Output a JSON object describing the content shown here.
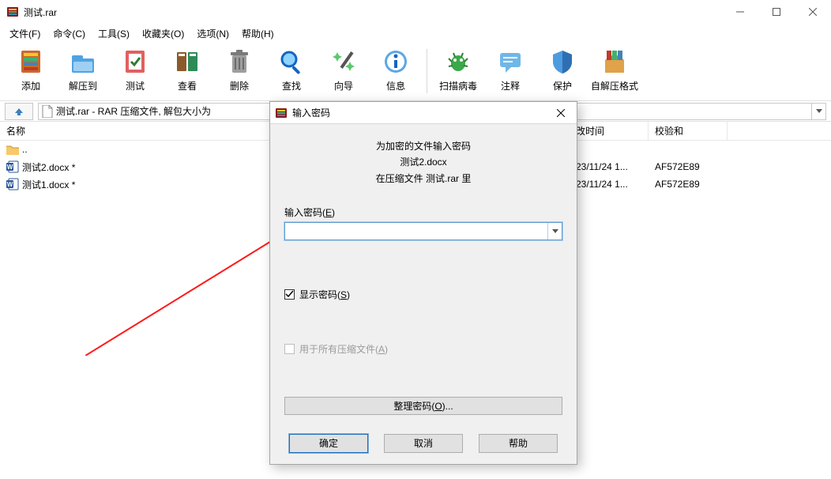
{
  "window": {
    "title": "测试.rar"
  },
  "menu": {
    "file": "文件(F)",
    "commands": "命令(C)",
    "tools": "工具(S)",
    "favorites": "收藏夹(O)",
    "options": "选项(N)",
    "help": "帮助(H)"
  },
  "toolbar": {
    "add": "添加",
    "extract": "解压到",
    "test": "测试",
    "view": "查看",
    "delete": "删除",
    "find": "查找",
    "wizard": "向导",
    "info": "信息",
    "virus": "扫描病毒",
    "comment": "注释",
    "protect": "保护",
    "sfx": "自解压格式"
  },
  "address": {
    "path": "测试.rar - RAR 压缩文件, 解包大小为"
  },
  "columns": {
    "name": "名称",
    "mtime": "改时间",
    "crc": "校验和"
  },
  "rows": [
    {
      "kind": "up",
      "name": "..",
      "mtime": "",
      "crc": ""
    },
    {
      "kind": "docx",
      "name": "测试2.docx *",
      "mtime": "23/11/24 1...",
      "crc": "AF572E89"
    },
    {
      "kind": "docx",
      "name": "测试1.docx *",
      "mtime": "23/11/24 1...",
      "crc": "AF572E89"
    }
  ],
  "dialog": {
    "title": "输入密码",
    "line1": "为加密的文件输入密码",
    "line2": "测试2.docx",
    "line3": "在压缩文件 测试.rar 里",
    "input_label_pre": "输入密码(",
    "input_label_key": "E",
    "input_label_post": ")",
    "input_value": "",
    "show_pw_pre": "显示密码(",
    "show_pw_key": "S",
    "show_pw_post": ")",
    "show_pw_checked": true,
    "all_arch_pre": "用于所有压缩文件(",
    "all_arch_key": "A",
    "all_arch_post": ")",
    "all_arch_checked": false,
    "all_arch_enabled": false,
    "organize_pre": "整理密码(",
    "organize_key": "O",
    "organize_post": ")...",
    "ok": "确定",
    "cancel": "取消",
    "help": "帮助"
  }
}
